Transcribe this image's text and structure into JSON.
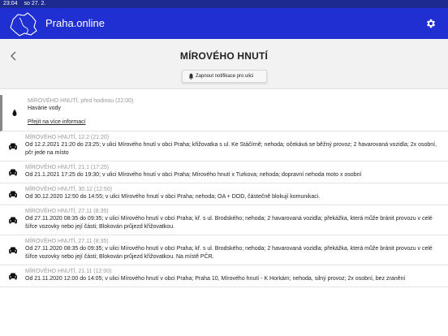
{
  "statusbar": {
    "time": "23:04",
    "date": "so 27. 2."
  },
  "app": {
    "title": "Praha.online"
  },
  "header": {
    "street": "MÍROVÉHO HNUTÍ",
    "notify_label": "Zapnout notifikace pro ulici"
  },
  "events": [
    {
      "meta": "MÍROVÉHO HNUTÍ, před hodinou (22:00)",
      "text": "Havárie vody",
      "link": "Přejít na více informací",
      "icon": "water-drop-icon"
    },
    {
      "meta": "MÍROVÉHO HNUTÍ, 12.2 (21:20)",
      "text": "Od 12.2.2021 21:20 do 23:25; v ulici Mírového hnutí v obci Praha; křižovatka s ul. Ke Stáčírně; nehoda; očekává se běžný provoz; 2 havarovaná vozidla; 2x osobní, pčr jede na místo",
      "icon": "car-icon"
    },
    {
      "meta": "MÍROVÉHO HNUTÍ, 21.1 (17:25)",
      "text": "Od 21.1.2021 17:25 do 19:30; v ulici Mírového hnutí v obci Praha; Mírového hnutí x Turkova; nehoda; dopravní nehoda moto x osobní",
      "icon": "car-icon"
    },
    {
      "meta": "MÍROVÉHO HNUTÍ, 30.12 (12:50)",
      "text": "Od 30.12.2020 12:50 do 14:55; v ulici Mírového hnutí v obci Praha; nehoda; OA + DOD, částečně blokují komunikaci.",
      "icon": "car-icon"
    },
    {
      "meta": "MÍROVÉHO HNUTÍ, 27.11 (8:35)",
      "text": "Od 27.11.2020 08:35 do 09:35; v ulici Mírového hnutí v obci Praha; kř. s ul. Brodského; nehoda; 2 havarovaná vozidla; překážka, která může bránit provozu v celé šířce vozovky nebo její části; Blokován průjezd křižovatkou.",
      "icon": "car-icon"
    },
    {
      "meta": "MÍROVÉHO HNUTÍ, 27.11 (8:35)",
      "text": "Od 27.11.2020 08:35 do 09:35; v ulici Mírového hnutí v obci Praha; kř. s ul. Brodského; nehoda; 2 havarovaná vozidla; překážka, která může bránit provozu v celé šířce vozovky nebo její části; Blokován průjezd křižovatkou. Na místě PČR.",
      "icon": "car-icon"
    },
    {
      "meta": "MÍROVÉHO HNUTÍ, 21.11 (12:00)",
      "text": "Od 21.11.2020 12:00 do 14:05; v ulici Mírového hnutí v obci Praha; Praha 10, Mírového hnutí - K Horkám; nehoda, silný provoz; 2x osobní, bez zranění",
      "icon": "car-icon"
    }
  ],
  "colors": {
    "appbar": "#1f2fd1",
    "statusbar": "#1d2a8f",
    "subheader": "#f2f2f2"
  }
}
